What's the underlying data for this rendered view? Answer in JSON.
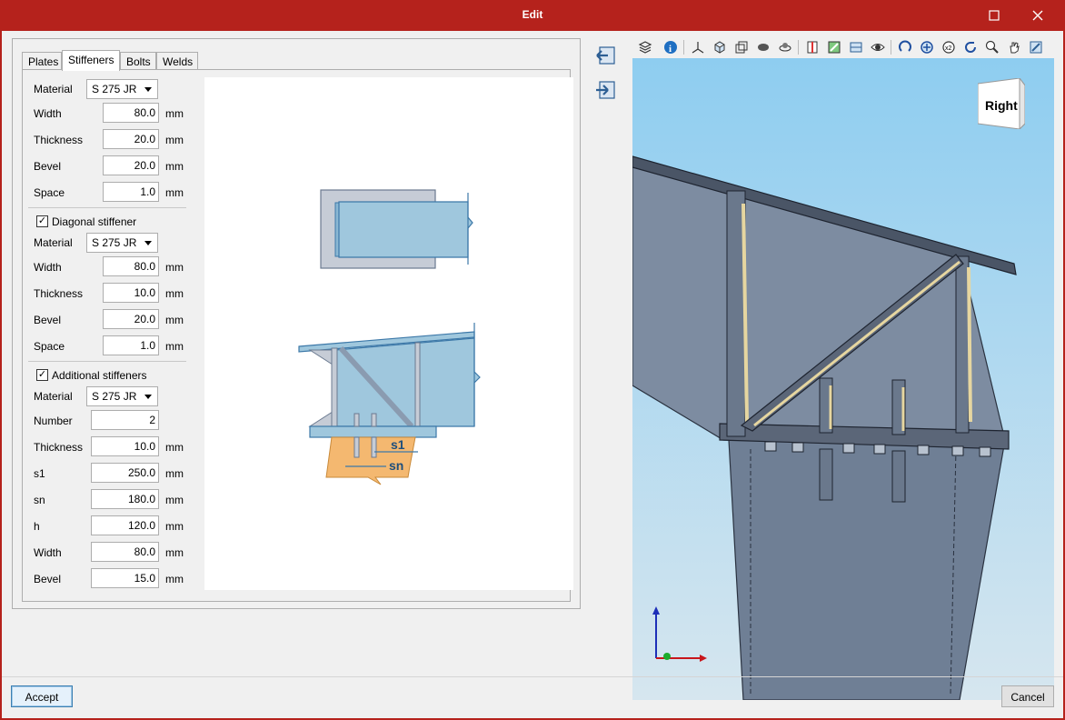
{
  "window": {
    "title": "Edit",
    "maximize_icon": "maximize-icon",
    "close_icon": "close-icon"
  },
  "tabs": [
    "Plates",
    "Stiffeners",
    "Bolts",
    "Welds"
  ],
  "active_tab": "Stiffeners",
  "form": {
    "stiffener": {
      "material_label": "Material",
      "material_value": "S 275 JR",
      "width_label": "Width",
      "width_value": "80.0",
      "width_unit": "mm",
      "thickness_label": "Thickness",
      "thickness_value": "20.0",
      "thickness_unit": "mm",
      "bevel_label": "Bevel",
      "bevel_value": "20.0",
      "bevel_unit": "mm",
      "space_label": "Space",
      "space_value": "1.0",
      "space_unit": "mm"
    },
    "diagonal": {
      "check_label": "Diagonal stiffener",
      "checked": true,
      "material_label": "Material",
      "material_value": "S 275 JR",
      "width_label": "Width",
      "width_value": "80.0",
      "width_unit": "mm",
      "thickness_label": "Thickness",
      "thickness_value": "10.0",
      "thickness_unit": "mm",
      "bevel_label": "Bevel",
      "bevel_value": "20.0",
      "bevel_unit": "mm",
      "space_label": "Space",
      "space_value": "1.0",
      "space_unit": "mm"
    },
    "additional": {
      "check_label": "Additional stiffeners",
      "checked": true,
      "material_label": "Material",
      "material_value": "S 275 JR",
      "number_label": "Number",
      "number_value": "2",
      "thickness_label": "Thickness",
      "thickness_value": "10.0",
      "thickness_unit": "mm",
      "s1_label": "s1",
      "s1_value": "250.0",
      "s1_unit": "mm",
      "sn_label": "sn",
      "sn_value": "180.0",
      "sn_unit": "mm",
      "h_label": "h",
      "h_value": "120.0",
      "h_unit": "mm",
      "width_label": "Width",
      "width_value": "80.0",
      "width_unit": "mm",
      "bevel_label": "Bevel",
      "bevel_value": "15.0",
      "bevel_unit": "mm"
    }
  },
  "diagram": {
    "s1_label": "s1",
    "sn_label": "sn"
  },
  "side_buttons": [
    "import-icon",
    "export-icon"
  ],
  "viewer": {
    "cube_label": "Right",
    "toolbar_icons": [
      "layers-icon",
      "info-icon",
      "axes-icon",
      "cube-view-icon",
      "wireframe-icon",
      "shaded-icon",
      "orbit-icon",
      "section-icon",
      "fit-icon",
      "grid-icon",
      "eye-icon",
      "rotate-icon",
      "zoom-all-icon",
      "zoom-window-icon",
      "refresh-icon",
      "zoom-icon",
      "pan-icon",
      "snapshot-icon"
    ]
  },
  "buttons": {
    "accept": "Accept",
    "cancel": "Cancel"
  },
  "colors": {
    "titlebar": "#b5221c",
    "steel": "#8a9bb0",
    "weld": "#e6d6a0",
    "sky_top": "#8ecdf0"
  }
}
